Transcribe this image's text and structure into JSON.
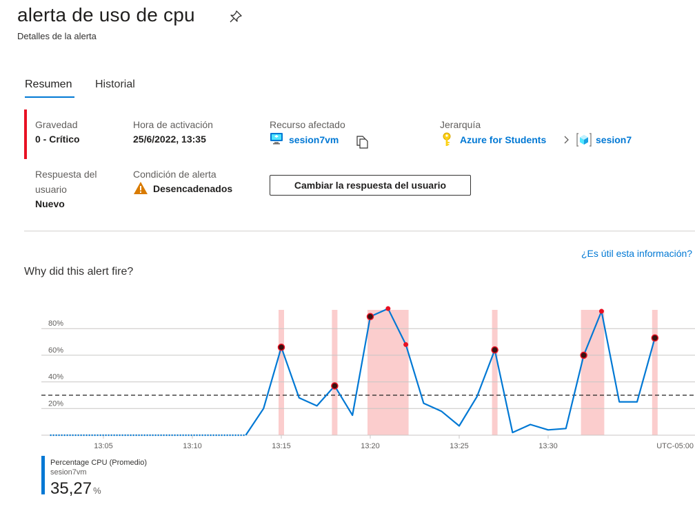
{
  "header": {
    "title": "alerta de uso de cpu",
    "subtitle": "Detalles de la alerta"
  },
  "tabs": [
    {
      "label": "Resumen",
      "selected": true
    },
    {
      "label": "Historial",
      "selected": false
    }
  ],
  "details": {
    "severity_label": "Gravedad",
    "severity_value": "0 - Crítico",
    "activation_label": "Hora de activación",
    "activation_value": "25/6/2022, 13:35",
    "resource_label": "Recurso afectado",
    "resource_value": "sesion7vm",
    "hierarchy_label": "Jerarquía",
    "hierarchy_subscription": "Azure for Students",
    "hierarchy_group": "sesion7",
    "response_label_line1": "Respuesta del",
    "response_label_line2": "usuario",
    "response_value": "Nuevo",
    "condition_label": "Condición de alerta",
    "condition_value": "Desencadenados",
    "change_response_button": "Cambiar la respuesta del usuario"
  },
  "helpful_link": "¿Es útil esta información?",
  "chart_title": "Why did this alert fire?",
  "colors": {
    "accent": "#0078d4",
    "critical": "#e81123",
    "highlight": "#fbcaca",
    "warning": "#d97b00"
  },
  "chart_data": {
    "type": "line",
    "x_tick_labels": [
      "13:05",
      "13:10",
      "13:15",
      "13:20",
      "13:25",
      "13:30"
    ],
    "timezone_label": "UTC-05:00",
    "y_tick_labels": [
      "20%",
      "40%",
      "60%",
      "80%"
    ],
    "ylim": [
      0,
      100
    ],
    "threshold": 30,
    "grid": true,
    "legend_position": "bottom-left",
    "series": [
      {
        "name": "Percentage CPU (Promedio)",
        "x": [
          "13:02",
          "13:13",
          "13:14",
          "13:15",
          "13:16",
          "13:17",
          "13:18",
          "13:19",
          "13:20",
          "13:21",
          "13:22",
          "13:23",
          "13:24",
          "13:25",
          "13:26",
          "13:27",
          "13:28",
          "13:29",
          "13:30",
          "13:31",
          "13:32",
          "13:33",
          "13:34",
          "13:35",
          "13:36"
        ],
        "y": [
          0,
          0,
          20,
          66,
          28,
          22,
          37,
          15,
          89,
          95,
          68,
          24,
          18,
          7,
          29,
          64,
          2,
          8,
          4,
          5,
          60,
          93,
          25,
          25,
          73
        ],
        "missing_until": "13:13"
      }
    ],
    "alert_windows": [
      [
        "13:15",
        "13:15"
      ],
      [
        "13:18",
        "13:18"
      ],
      [
        "13:20",
        "13:22"
      ],
      [
        "13:27",
        "13:27"
      ],
      [
        "13:32",
        "13:33"
      ],
      [
        "13:36",
        "13:36"
      ]
    ],
    "fired_points": [
      {
        "x": "13:15",
        "y": 66
      },
      {
        "x": "13:18",
        "y": 37
      },
      {
        "x": "13:20",
        "y": 89
      },
      {
        "x": "13:27",
        "y": 64
      },
      {
        "x": "13:32",
        "y": 60
      },
      {
        "x": "13:36",
        "y": 73
      }
    ],
    "breach_points": [
      {
        "x": "13:21",
        "y": 95
      },
      {
        "x": "13:22",
        "y": 68
      },
      {
        "x": "13:33",
        "y": 93
      }
    ]
  },
  "legend": {
    "metric": "Percentage CPU (Promedio)",
    "resource": "sesion7vm",
    "value": "35,27",
    "unit": "%"
  }
}
